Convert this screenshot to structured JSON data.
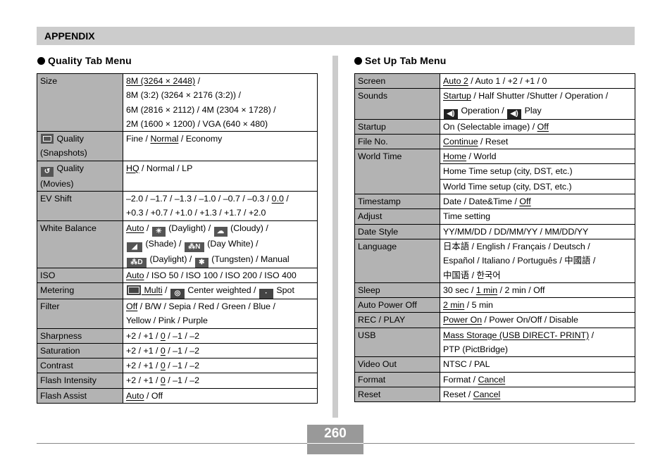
{
  "header": {
    "title": "APPENDIX"
  },
  "quality": {
    "title": "Quality Tab Menu",
    "rows": [
      {
        "label": "Size",
        "lines": [
          "8M (3264 × 2448) /",
          "8M (3:2) (3264 × 2176 (3:2)) /",
          "6M (2816 × 2112) / 4M (2304 × 1728) /",
          "2M (1600 × 1200) / VGA (640 × 480)"
        ],
        "default": "8M (3264 × 2448)"
      },
      {
        "label": "Quality (Snapshots)",
        "icon": "snapshot-quality-icon",
        "options": [
          "Fine",
          "Normal",
          "Economy"
        ],
        "default": "Normal"
      },
      {
        "label": "Quality (Movies)",
        "icon": "movie-quality-icon",
        "options": [
          "HQ",
          "Normal",
          "LP"
        ],
        "default": "HQ"
      },
      {
        "label": "EV Shift",
        "lines": [
          "–2.0 / –1.7 / –1.3 / –1.0 / –0.7 / –0.3 / 0.0 /",
          "+0.3 / +0.7 / +1.0 / +1.3 / +1.7 / +2.0"
        ],
        "default": "0.0"
      },
      {
        "label": "White Balance",
        "options": [
          "Auto",
          "(Daylight)",
          "(Cloudy)",
          "(Shade)",
          "(Day White)",
          "(Daylight)",
          "(Tungsten)",
          "Manual"
        ],
        "default": "Auto"
      },
      {
        "label": "ISO",
        "options": [
          "Auto",
          "ISO 50",
          "ISO 100",
          "ISO 200",
          "ISO 400"
        ],
        "default": "Auto"
      },
      {
        "label": "Metering",
        "options": [
          "Multi",
          "Center weighted",
          "Spot"
        ],
        "default": "Multi"
      },
      {
        "label": "Filter",
        "lines": [
          "Off / B/W / Sepia / Red / Green / Blue /",
          "Yellow / Pink / Purple"
        ],
        "default": "Off"
      },
      {
        "label": "Sharpness",
        "value": "+2 / +1 / 0 / –1 / –2",
        "default": "0"
      },
      {
        "label": "Saturation",
        "value": "+2 / +1 / 0 / –1 / –2",
        "default": "0"
      },
      {
        "label": "Contrast",
        "value": "+2 / +1 / 0 / –1 / –2",
        "default": "0"
      },
      {
        "label": "Flash Intensity",
        "value": "+2 / +1 / 0 / –1 / –2",
        "default": "0"
      },
      {
        "label": "Flash Assist",
        "value": "Auto / Off",
        "default": "Auto"
      }
    ]
  },
  "setup": {
    "title": "Set Up Tab Menu",
    "rows": [
      {
        "label": "Screen",
        "value": "Auto 2 / Auto 1 / +2 / +1 / 0",
        "default": "Auto 2"
      },
      {
        "label": "Sounds",
        "lines": [
          "Startup / Half Shutter /Shutter / Operation /",
          "Operation / Play"
        ],
        "default": "Startup"
      },
      {
        "label": "Startup",
        "value": "On (Selectable image) / Off",
        "default": "Off"
      },
      {
        "label": "File No.",
        "value": "Continue / Reset",
        "default": "Continue"
      },
      {
        "label": "World Time",
        "lines": [
          "Home / World",
          "Home Time setup (city, DST, etc.)",
          "World Time setup (city, DST, etc.)"
        ],
        "default": "Home"
      },
      {
        "label": "Timestamp",
        "value": "Date / Date&Time / Off",
        "default": "Off"
      },
      {
        "label": "Adjust",
        "value": "Time setting"
      },
      {
        "label": "Date Style",
        "value": "YY/MM/DD / DD/MM/YY / MM/DD/YY"
      },
      {
        "label": "Language",
        "lines": [
          "日本語 / English / Français / Deutsch /",
          "Español / Italiano / Português / 中國語 /",
          "中国语 / 한국어"
        ]
      },
      {
        "label": "Sleep",
        "value": "30 sec / 1 min / 2 min / Off",
        "default": "1 min"
      },
      {
        "label": "Auto Power Off",
        "value": "2 min / 5 min",
        "default": "2 min"
      },
      {
        "label": "REC / PLAY",
        "value": "Power On / Power On/Off / Disable",
        "default": "Power On"
      },
      {
        "label": "USB",
        "lines": [
          "Mass Storage (USB DIRECT- PRINT) /",
          "PTP (PictBridge)"
        ],
        "default": "Mass Storage (USB DIRECT- PRINT)"
      },
      {
        "label": "Video Out",
        "value": "NTSC / PAL"
      },
      {
        "label": "Format",
        "value": "Format / Cancel",
        "default": "Cancel"
      },
      {
        "label": "Reset",
        "value": "Reset / Cancel",
        "default": "Cancel"
      }
    ]
  },
  "page_number": "260"
}
